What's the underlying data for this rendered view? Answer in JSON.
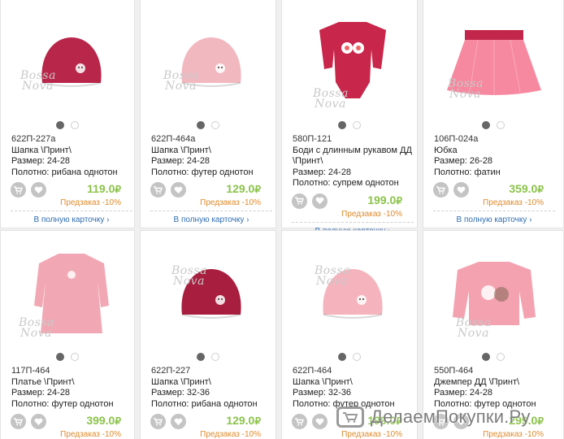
{
  "watermark": {
    "line1": "Bossa",
    "line2": "Nova"
  },
  "common": {
    "full_card": "В полную карточку",
    "preorder": "Предзаказ -10%",
    "currency": "₽"
  },
  "products": [
    {
      "code": "622П-227а",
      "name": "Шапка \\Принт\\",
      "size": "Размер: 24-28",
      "fabric": "Полотно: рибана однотон",
      "price": "119.0",
      "color": "#b8264a",
      "kind": "hat"
    },
    {
      "code": "622П-464а",
      "name": "Шапка \\Принт\\",
      "size": "Размер: 24-28",
      "fabric": "Полотно: футер однотон",
      "price": "129.0",
      "color": "#f2b8c0",
      "kind": "hat"
    },
    {
      "code": "580П-121",
      "name": "Боди с длинным рукавом ДД \\Принт\\",
      "size": "Размер: 24-28",
      "fabric": "Полотно: супрем однотон",
      "price": "199.0",
      "color": "#c8264a",
      "kind": "bodysuit"
    },
    {
      "code": "106П-024а",
      "name": "Юбка",
      "size": "Размер: 26-28",
      "fabric": "Полотно: фатин",
      "price": "359.0",
      "color": "#f57b95",
      "kind": "skirt"
    },
    {
      "code": "117П-464",
      "name": "Платье \\Принт\\",
      "size": "Размер: 24-28",
      "fabric": "Полотно: футер однотон",
      "price": "399.0",
      "color": "#f2a8b4",
      "kind": "dress"
    },
    {
      "code": "622П-227",
      "name": "Шапка \\Принт\\",
      "size": "Размер: 32-36",
      "fabric": "Полотно: рибана однотон",
      "price": "129.0",
      "color": "#a81e3e",
      "kind": "hat"
    },
    {
      "code": "622П-464",
      "name": "Шапка \\Принт\\",
      "size": "Размер: 32-36",
      "fabric": "Полотно: футер однотон",
      "price": "199.0",
      "color": "#f4b3bd",
      "kind": "hat"
    },
    {
      "code": "550П-464",
      "name": "Джемпер ДД \\Принт\\",
      "size": "Размер: 24-28",
      "fabric": "Полотно: футер однотон",
      "price": "299.0",
      "color": "#f4a2b0",
      "kind": "sweater"
    }
  ],
  "overlay": {
    "site": "ДелаемПокупки.Ру"
  }
}
